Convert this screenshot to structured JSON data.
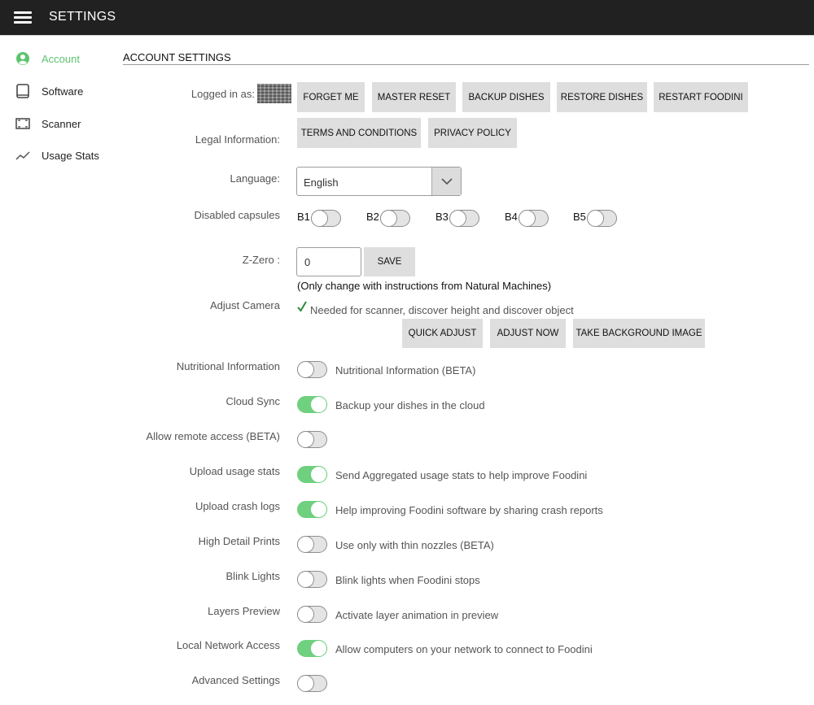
{
  "header": {
    "title": "SETTINGS"
  },
  "sidebar": {
    "items": [
      {
        "label": "Account",
        "icon": "account-circle-icon",
        "active": true
      },
      {
        "label": "Software",
        "icon": "tablet-icon"
      },
      {
        "label": "Scanner",
        "icon": "scanner-icon"
      },
      {
        "label": "Usage Stats",
        "icon": "trending-line-icon"
      }
    ]
  },
  "section": {
    "title": "ACCOUNT SETTINGS"
  },
  "account": {
    "logged_in_label": "Logged in as:",
    "buttons": [
      "FORGET ME",
      "MASTER RESET",
      "BACKUP DISHES",
      "RESTORE DISHES",
      "RESTART FOODINI"
    ]
  },
  "legal": {
    "label": "Legal Information:",
    "buttons": [
      "TERMS AND CONDITIONS",
      "PRIVACY POLICY"
    ]
  },
  "language": {
    "label": "Language:",
    "value": "English"
  },
  "capsules": {
    "label": "Disabled capsules",
    "items": [
      {
        "name": "B1",
        "on": false
      },
      {
        "name": "B2",
        "on": false
      },
      {
        "name": "B3",
        "on": false
      },
      {
        "name": "B4",
        "on": false
      },
      {
        "name": "B5",
        "on": false
      }
    ]
  },
  "zzero": {
    "label": "Z-Zero :",
    "value": "0",
    "save_label": "SAVE",
    "note": "(Only change with instructions from Natural Machines)"
  },
  "camera": {
    "label": "Adjust Camera",
    "status": "Needed for scanner, discover height and discover object",
    "buttons": [
      "QUICK ADJUST",
      "ADJUST NOW",
      "TAKE BACKGROUND IMAGE"
    ]
  },
  "toggles": [
    {
      "label": "Nutritional Information",
      "on": false,
      "description": "Nutritional Information (BETA)"
    },
    {
      "label": "Cloud Sync",
      "on": true,
      "description": "Backup your dishes in the cloud"
    },
    {
      "label": "Allow remote access (BETA)",
      "on": false,
      "description": ""
    },
    {
      "label": "Upload usage stats",
      "on": true,
      "description": "Send Aggregated usage stats to help improve Foodini"
    },
    {
      "label": "Upload crash logs",
      "on": true,
      "description": "Help improving Foodini software by sharing crash reports"
    },
    {
      "label": "High Detail Prints",
      "on": false,
      "description": "Use only with thin nozzles (BETA)"
    },
    {
      "label": "Blink Lights",
      "on": false,
      "description": "Blink lights when Foodini stops"
    },
    {
      "label": "Layers Preview",
      "on": false,
      "description": "Activate layer animation in preview"
    },
    {
      "label": "Local Network Access",
      "on": true,
      "description": "Allow computers on your network to connect to Foodini"
    },
    {
      "label": "Advanced Settings",
      "on": false,
      "description": ""
    }
  ],
  "colors": {
    "accent": "#5cc46f",
    "toggle_on": "#6fd07f",
    "topbar": "#212121",
    "button": "#dedede"
  }
}
